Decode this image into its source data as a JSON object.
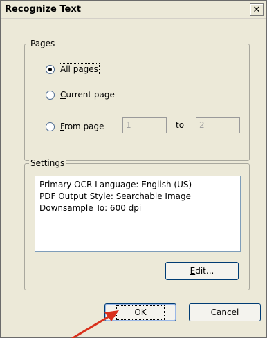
{
  "window": {
    "title": "Recognize Text",
    "close_glyph": "✕"
  },
  "pages": {
    "group_label": "Pages",
    "options": [
      {
        "label": "All pages",
        "checked": true
      },
      {
        "label": "Current page",
        "checked": false
      },
      {
        "label": "From page",
        "checked": false
      }
    ],
    "from_value": "1",
    "to_label": "to",
    "to_value": "2"
  },
  "settings": {
    "group_label": "Settings",
    "lines": [
      "Primary OCR Language: English (US)",
      "PDF Output Style: Searchable Image",
      "Downsample To: 600 dpi"
    ],
    "edit_label": "Edit..."
  },
  "buttons": {
    "ok_label": "OK",
    "cancel_label": "Cancel"
  },
  "annotation": {
    "arrow_color": "#d9301c"
  }
}
